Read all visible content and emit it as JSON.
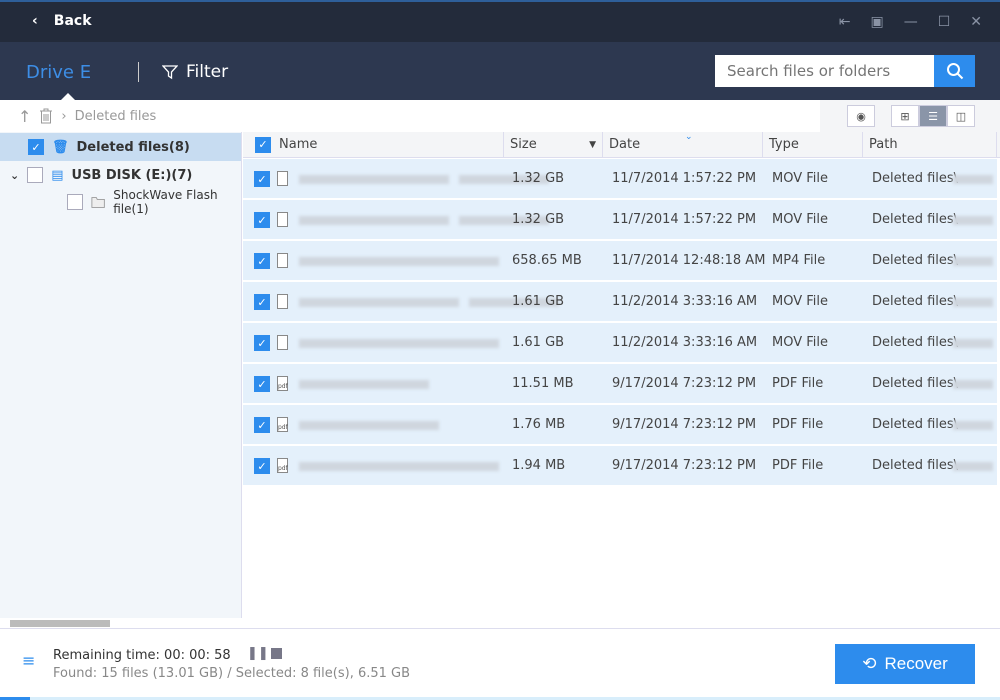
{
  "titlebar": {
    "back_label": "Back"
  },
  "header": {
    "drive_label": "Drive E",
    "filter_label": "Filter",
    "search_placeholder": "Search files or folders"
  },
  "breadcrumb": {
    "current": "Deleted files"
  },
  "tree": [
    {
      "label": "Deleted files(8)",
      "checked": true
    },
    {
      "label": "USB DISK (E:)(7)",
      "checked": false
    },
    {
      "label": "ShockWave Flash file(1)",
      "checked": false
    }
  ],
  "columns": {
    "name": "Name",
    "size": "Size",
    "date": "Date",
    "type": "Type",
    "path": "Path"
  },
  "rows": [
    {
      "size": "1.32 GB",
      "date": "11/7/2014 1:57:22 PM",
      "type": "MOV File",
      "path": "Deleted files\\"
    },
    {
      "size": "1.32 GB",
      "date": "11/7/2014 1:57:22 PM",
      "type": "MOV File",
      "path": "Deleted files\\"
    },
    {
      "size": "658.65 MB",
      "date": "11/7/2014 12:48:18 AM",
      "type": "MP4 File",
      "path": "Deleted files\\"
    },
    {
      "size": "1.61 GB",
      "date": "11/2/2014 3:33:16 AM",
      "type": "MOV File",
      "path": "Deleted files\\"
    },
    {
      "size": "1.61 GB",
      "date": "11/2/2014 3:33:16 AM",
      "type": "MOV File",
      "path": "Deleted files\\"
    },
    {
      "size": "11.51 MB",
      "date": "9/17/2014 7:23:12 PM",
      "type": "PDF File",
      "path": "Deleted files\\"
    },
    {
      "size": "1.76 MB",
      "date": "9/17/2014 7:23:12 PM",
      "type": "PDF File",
      "path": "Deleted files\\"
    },
    {
      "size": "1.94 MB",
      "date": "9/17/2014 7:23:12 PM",
      "type": "PDF File",
      "path": "Deleted files\\"
    }
  ],
  "footer": {
    "remaining": "Remaining time: 00: 00: 58",
    "found": "Found: 15 files (13.01 GB) / Selected: 8 file(s), 6.51 GB",
    "recover_label": "Recover",
    "progress_percent": 3
  },
  "colors": {
    "accent": "#2d8ced",
    "titlebar": "#232b3b",
    "header": "#2d3850",
    "row_selected": "#e4f0fb"
  }
}
